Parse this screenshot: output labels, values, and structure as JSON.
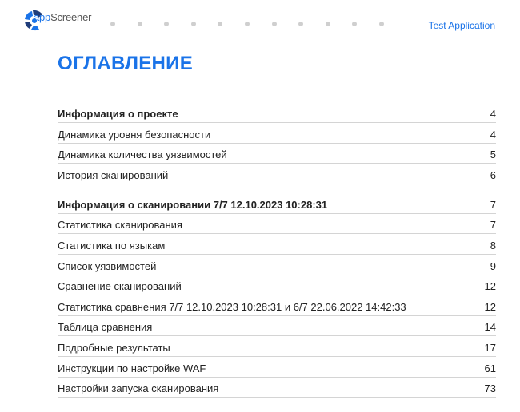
{
  "header": {
    "logo_text_prefix": "app",
    "logo_text_suffix": "Screener",
    "app_name": "Test Application",
    "colors": {
      "accent": "#1a73e8",
      "logo_dark": "#1f3d7a",
      "dot": "#cfcfcf"
    }
  },
  "title": "ОГЛАВЛЕНИЕ",
  "toc": [
    {
      "label": "Информация о проекте",
      "page": "4",
      "section": true
    },
    {
      "label": "Динамика уровня безопасности",
      "page": "4",
      "section": false
    },
    {
      "label": "Динамика количества уязвимостей",
      "page": "5",
      "section": false
    },
    {
      "label": "История сканирований",
      "page": "6",
      "section": false
    },
    {
      "label": "Информация о сканировании 7/7 12.10.2023 10:28:31",
      "page": "7",
      "section": true
    },
    {
      "label": "Статистика сканирования",
      "page": "7",
      "section": false
    },
    {
      "label": "Статистика по языкам",
      "page": "8",
      "section": false
    },
    {
      "label": "Список уязвимостей",
      "page": "9",
      "section": false
    },
    {
      "label": "Сравнение сканирований",
      "page": "12",
      "section": false
    },
    {
      "label": "Статистика сравнения 7/7 12.10.2023 10:28:31 и 6/7 22.06.2022 14:42:33",
      "page": "12",
      "section": false
    },
    {
      "label": "Таблица сравнения",
      "page": "14",
      "section": false
    },
    {
      "label": "Подробные результаты",
      "page": "17",
      "section": false
    },
    {
      "label": "Инструкции по настройке WAF",
      "page": "61",
      "section": false
    },
    {
      "label": "Настройки запуска сканирования",
      "page": "73",
      "section": false
    }
  ]
}
